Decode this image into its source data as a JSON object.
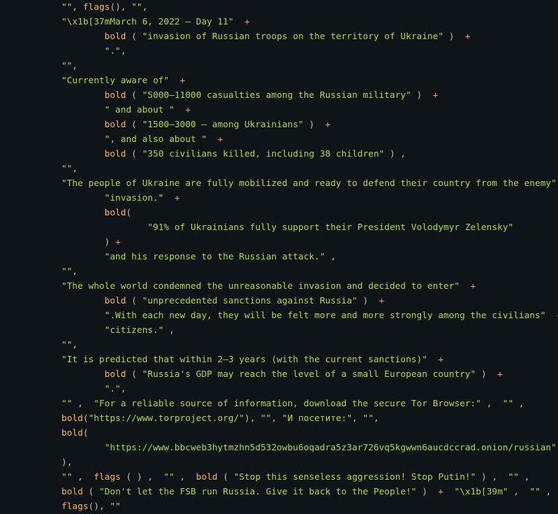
{
  "code": {
    "l01": {
      "a": "\"\"",
      "b": "flags",
      "c": "()",
      "d": "\"\""
    },
    "l02": {
      "a": "\"\\x1b[37mMarch 6, 2022 — Day 11\""
    },
    "l03": {
      "a": "bold",
      "b": "\"invasion of Russian troops on the territory of Ukraine\""
    },
    "l04": {
      "a": "\".\""
    },
    "l05": {
      "a": "\"\""
    },
    "l06": {
      "a": "\"Currently aware of\""
    },
    "l07": {
      "a": "bold",
      "b": "\"5000–11000 casualties among the Russian military\""
    },
    "l08": {
      "a": "\" and about \""
    },
    "l09": {
      "a": "bold",
      "b": "\"1500–3000 — among Ukrainians\""
    },
    "l10": {
      "a": "\", and also about \""
    },
    "l11": {
      "a": "bold",
      "b": "\"350 civilians killed, including 38 children\""
    },
    "l12": {
      "a": "\"\""
    },
    "l13": {
      "a": "\"The people of Ukraine are fully mobilized and ready to defend their country from the enemy\""
    },
    "l14": {
      "a": "\"invasion.\""
    },
    "l15": {
      "a": "bold"
    },
    "l16": {
      "a": "\"91% of Ukrainians fully support their President Volodymyr Zelensky\""
    },
    "l17": {
      "a": "\"and his response to the Russian attack.\""
    },
    "l18": {
      "a": "\"\""
    },
    "l19": {
      "a": "\"The whole world condemned the unreasonable invasion and decided to enter\""
    },
    "l20": {
      "a": "bold",
      "b": "\"unprecedented sanctions against Russia\""
    },
    "l21": {
      "a": "\".With each new day, they will be felt more and more strongly among the civilians\""
    },
    "l22": {
      "a": "\"citizens.\""
    },
    "l23": {
      "a": "\"\""
    },
    "l24": {
      "a": "\"It is predicted that within 2–3 years (with the current sanctions)\""
    },
    "l25": {
      "a": "bold",
      "b": "\"Russia's GDP may reach the level of a small European country\""
    },
    "l26": {
      "a": "\".\""
    },
    "l27": {
      "a": "\"\"",
      "b": "\"For a reliable source of information, download the secure Tor Browser:\"",
      "c": "\"\""
    },
    "l28": {
      "a": "bold",
      "b": "\"https://www.torproject.org/\"",
      "c": "\"\"",
      "d": "\"И посетите:\"",
      "e": "\"\""
    },
    "l29": {
      "a": "bold"
    },
    "l30": {
      "a": "\"https://www.bbcweb3hytmzhn5d532owbu6oqadra5z3ar726vq5kgwwn6aucdccrad.onion/russian\""
    },
    "l31": {},
    "l32": {
      "a": "\"\"",
      "b": "flags",
      "c": "\"\"",
      "d": "bold",
      "e": "\"Stop this senseless aggression! Stop Putin!\"",
      "f": "\"\""
    },
    "l33": {
      "a": "bold",
      "b": "\"Don't let the FSB run Russia. Give it back to the People!\"",
      "c": "\"\\x1b[39m\"",
      "d": "\"\""
    },
    "l34": {
      "a": "flags",
      "b": "\"\""
    },
    "plus": "+"
  }
}
